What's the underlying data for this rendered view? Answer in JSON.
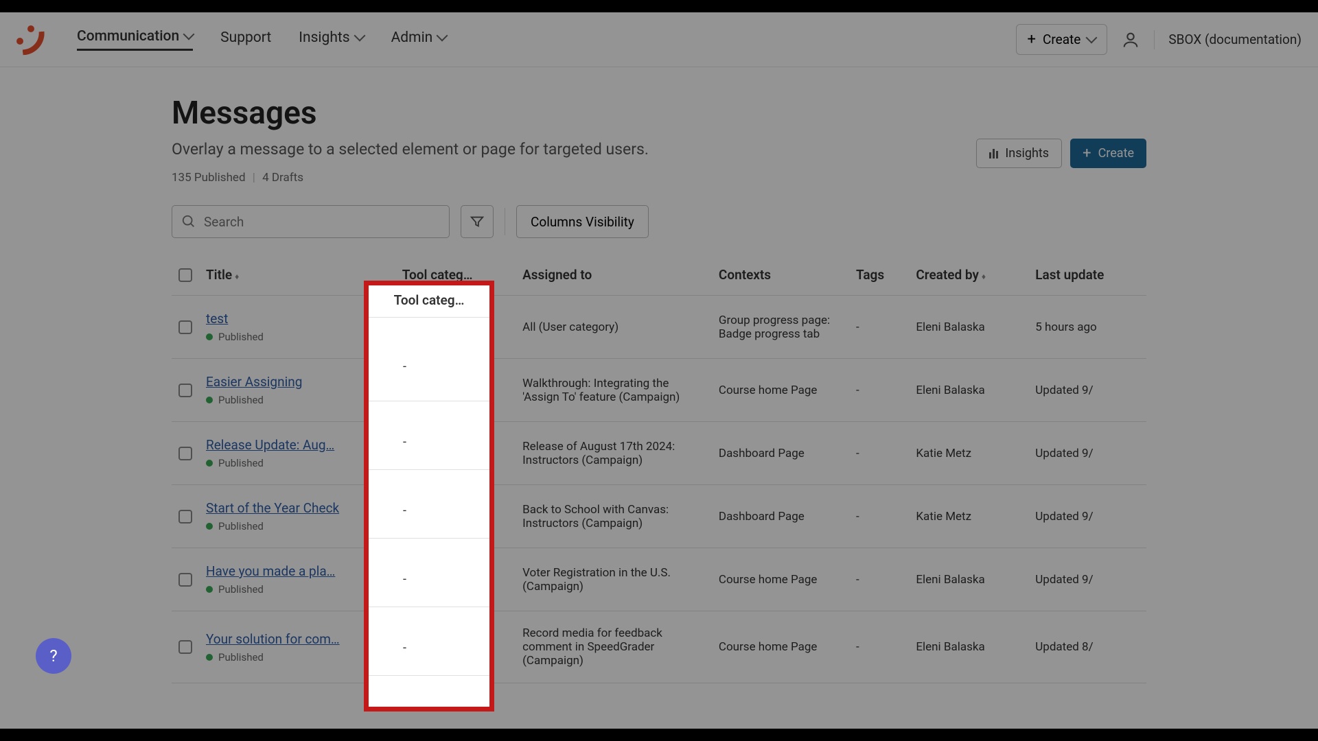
{
  "nav": {
    "items": [
      {
        "label": "Communication",
        "hasDropdown": true,
        "active": true
      },
      {
        "label": "Support",
        "hasDropdown": false,
        "active": false
      },
      {
        "label": "Insights",
        "hasDropdown": true,
        "active": false
      },
      {
        "label": "Admin",
        "hasDropdown": true,
        "active": false
      }
    ],
    "create_label": "Create",
    "account_label": "SBOX (documentation)"
  },
  "page": {
    "title": "Messages",
    "subtitle": "Overlay a message to a selected element or page for targeted users.",
    "published_count": "135 Published",
    "drafts_count": "4 Drafts",
    "insights_btn": "Insights",
    "create_btn": "Create"
  },
  "toolbar": {
    "search_placeholder": "Search",
    "columns_btn": "Columns Visibility"
  },
  "table": {
    "headers": {
      "title": "Title",
      "tool_category": "Tool categ…",
      "assigned_to": "Assigned to",
      "contexts": "Contexts",
      "tags": "Tags",
      "created_by": "Created by",
      "last_updated": "Last update"
    },
    "rows": [
      {
        "title": "test",
        "status": "Published",
        "tool_category": "-",
        "assigned_to": "All (User category)",
        "contexts": "Group progress page: Badge progress tab",
        "tags": "-",
        "created_by": "Eleni Balaska",
        "last_updated": "5 hours ago"
      },
      {
        "title": "Easier Assigning",
        "status": "Published",
        "tool_category": "-",
        "assigned_to": "Walkthrough: Integrating the 'Assign To' feature (Campaign)",
        "contexts": "Course home Page",
        "tags": "-",
        "created_by": "Eleni Balaska",
        "last_updated": "Updated 9/"
      },
      {
        "title": "Release Update: Aug…",
        "status": "Published",
        "tool_category": "-",
        "assigned_to": "Release of August 17th 2024: Instructors (Campaign)",
        "contexts": "Dashboard Page",
        "tags": "-",
        "created_by": "Katie Metz",
        "last_updated": "Updated 9/"
      },
      {
        "title": "Start of the Year Check",
        "status": "Published",
        "tool_category": "-",
        "assigned_to": "Back to School with Canvas: Instructors (Campaign)",
        "contexts": "Dashboard Page",
        "tags": "-",
        "created_by": "Katie Metz",
        "last_updated": "Updated 9/"
      },
      {
        "title": "Have you made a pla…",
        "status": "Published",
        "tool_category": "-",
        "assigned_to": "Voter Registration in the U.S. (Campaign)",
        "contexts": "Course home Page",
        "tags": "-",
        "created_by": "Eleni Balaska",
        "last_updated": "Updated 9/"
      },
      {
        "title": "Your solution for com…",
        "status": "Published",
        "tool_category": "-",
        "assigned_to": "Record media for feedback comment in SpeedGrader (Campaign)",
        "contexts": "Course home Page",
        "tags": "-",
        "created_by": "Eleni Balaska",
        "last_updated": "Updated 8/"
      }
    ]
  },
  "highlight_column_header": "Tool categ…"
}
